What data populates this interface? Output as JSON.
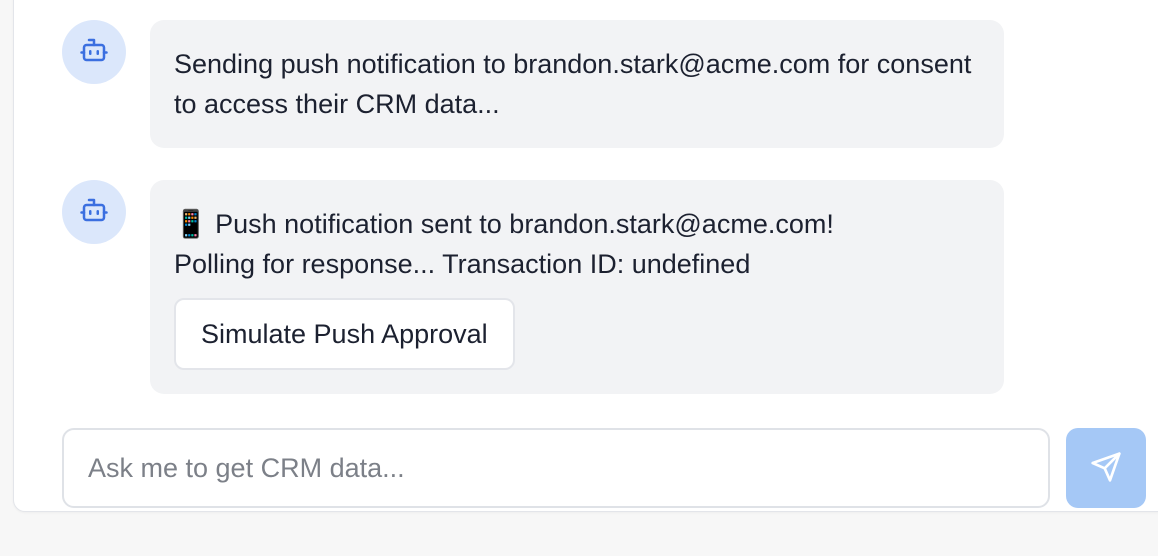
{
  "messages": [
    {
      "avatar_icon": "robot-icon",
      "text": "Sending push notification to brandon.stark@acme.com for consent to access their CRM data..."
    },
    {
      "avatar_icon": "robot-icon",
      "line1": "📱 Push notification sent to brandon.stark@acme.com!",
      "line2": "Polling for response... Transaction ID: undefined",
      "button_label": "Simulate Push Approval"
    }
  ],
  "composer": {
    "placeholder": "Ask me to get CRM data...",
    "value": "",
    "send_icon": "send-icon"
  },
  "colors": {
    "avatar_bg": "#dbe7fb",
    "avatar_icon": "#3b6fe0",
    "bubble_bg": "#f2f3f5",
    "send_button_bg": "#a5c8f6"
  }
}
